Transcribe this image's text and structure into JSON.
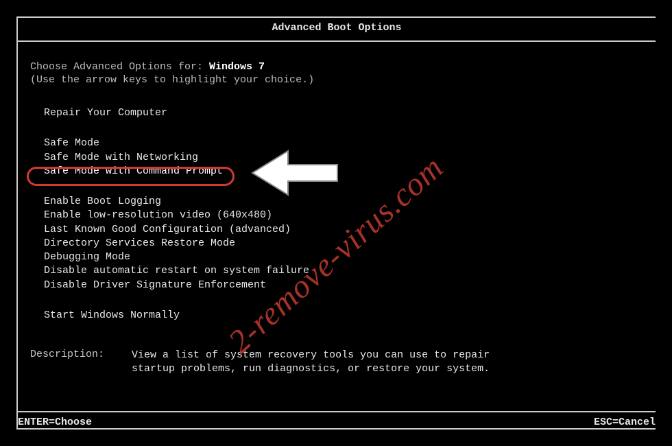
{
  "title": "Advanced Boot Options",
  "choose_prefix": "Choose Advanced Options for: ",
  "os": "Windows 7",
  "hint": "(Use the arrow keys to highlight your choice.)",
  "group1": {
    "items": [
      "Repair Your Computer"
    ]
  },
  "group2": {
    "items": [
      "Safe Mode",
      "Safe Mode with Networking",
      "Safe Mode with Command Prompt"
    ],
    "selected_index": 2
  },
  "group3": {
    "items": [
      "Enable Boot Logging",
      "Enable low-resolution video (640x480)",
      "Last Known Good Configuration (advanced)",
      "Directory Services Restore Mode",
      "Debugging Mode",
      "Disable automatic restart on system failure",
      "Disable Driver Signature Enforcement"
    ]
  },
  "group4": {
    "items": [
      "Start Windows Normally"
    ]
  },
  "description": {
    "label": "Description:",
    "text": "View a list of system recovery tools you can use to repair startup problems, run diagnostics, or restore your system."
  },
  "footer": {
    "enter": "ENTER=Choose",
    "esc": "ESC=Cancel"
  },
  "watermark": "2-remove-virus.com",
  "annotations": {
    "highlight_ring": true,
    "arrow_pointer": true
  }
}
